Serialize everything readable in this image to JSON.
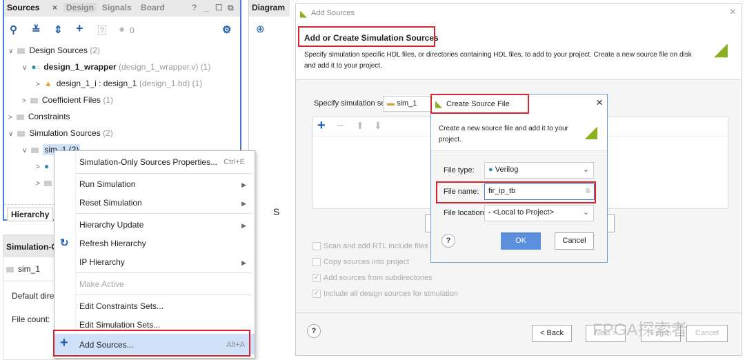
{
  "sources_panel": {
    "tabs": [
      "Sources",
      "Design",
      "Signals",
      "Board"
    ],
    "close": "×",
    "window_controls": [
      "?",
      "_",
      "☐",
      "⧉"
    ],
    "issue_count": "0",
    "tree": [
      {
        "label": "Design Sources",
        "count": "(2)"
      },
      {
        "label": "design_1_wrapper",
        "detail": "(design_1_wrapper.v) (1)"
      },
      {
        "label": "design_1_i : design_1",
        "detail": "(design_1.bd) (1)"
      },
      {
        "label": "Coefficient Files",
        "count": "(1)"
      },
      {
        "label": "Constraints"
      },
      {
        "label": "Simulation Sources",
        "count": "(2)"
      },
      {
        "label": "sim_1 (2)"
      }
    ],
    "bottom_tab": "Hierarchy"
  },
  "diagram_panel": {
    "tab": "Diagram"
  },
  "properties_panel": {
    "title": "Simulation-Only Sources Properties",
    "item": "sim_1",
    "fields": [
      "Default directory:",
      "File count:"
    ]
  },
  "stray_text": "S",
  "context_menu": {
    "items": [
      {
        "label": "Simulation-Only Sources Properties...",
        "shortcut": "Ctrl+E"
      },
      {
        "label": "Run Simulation"
      },
      {
        "label": "Reset Simulation"
      },
      {
        "label": "Hierarchy Update"
      },
      {
        "label": "Refresh Hierarchy"
      },
      {
        "label": "IP Hierarchy"
      },
      {
        "label": "Make Active",
        "disabled": true
      },
      {
        "label": "Edit Constraints Sets..."
      },
      {
        "label": "Edit Simulation Sets..."
      },
      {
        "label": "Add Sources...",
        "shortcut": "Alt+A"
      }
    ]
  },
  "add_sources": {
    "title": "Add Sources",
    "heading": "Add or Create Simulation Sources",
    "description": "Specify simulation specific HDL files, or directories containing HDL files, to add to your project. Create a new source file on disk and add it to your project.",
    "sim_set_label": "Specify simulation set:",
    "sim_set_value": "sim_1",
    "options": [
      {
        "label": "Scan and add RTL include files into project",
        "checked": false
      },
      {
        "label": "Copy sources into project",
        "checked": false
      },
      {
        "label": "Add sources from subdirectories",
        "checked": true
      },
      {
        "label": "Include all design sources for simulation",
        "checked": true
      }
    ],
    "buttons": {
      "help": "?",
      "back": "< Back",
      "next": "Next >",
      "finish": "Finish",
      "cancel": "Cancel"
    }
  },
  "create_source": {
    "title": "Create Source File",
    "description": "Create a new source file and add it to your project.",
    "file_type_label": "File type:",
    "file_type": "Verilog",
    "file_name_label": "File name:",
    "file_name": "fir_ip_tb",
    "file_location_label": "File location:",
    "file_location": "<Local to Project>",
    "ok": "OK",
    "cancel": "Cancel",
    "help": "?",
    "close": "×"
  },
  "watermark": "FPGA探索者",
  "colors": {
    "accent": "#4a7bd0",
    "highlight": "#d9232e",
    "ok_button": "#5b8fdc",
    "menu_hover": "#cfe0f8"
  }
}
